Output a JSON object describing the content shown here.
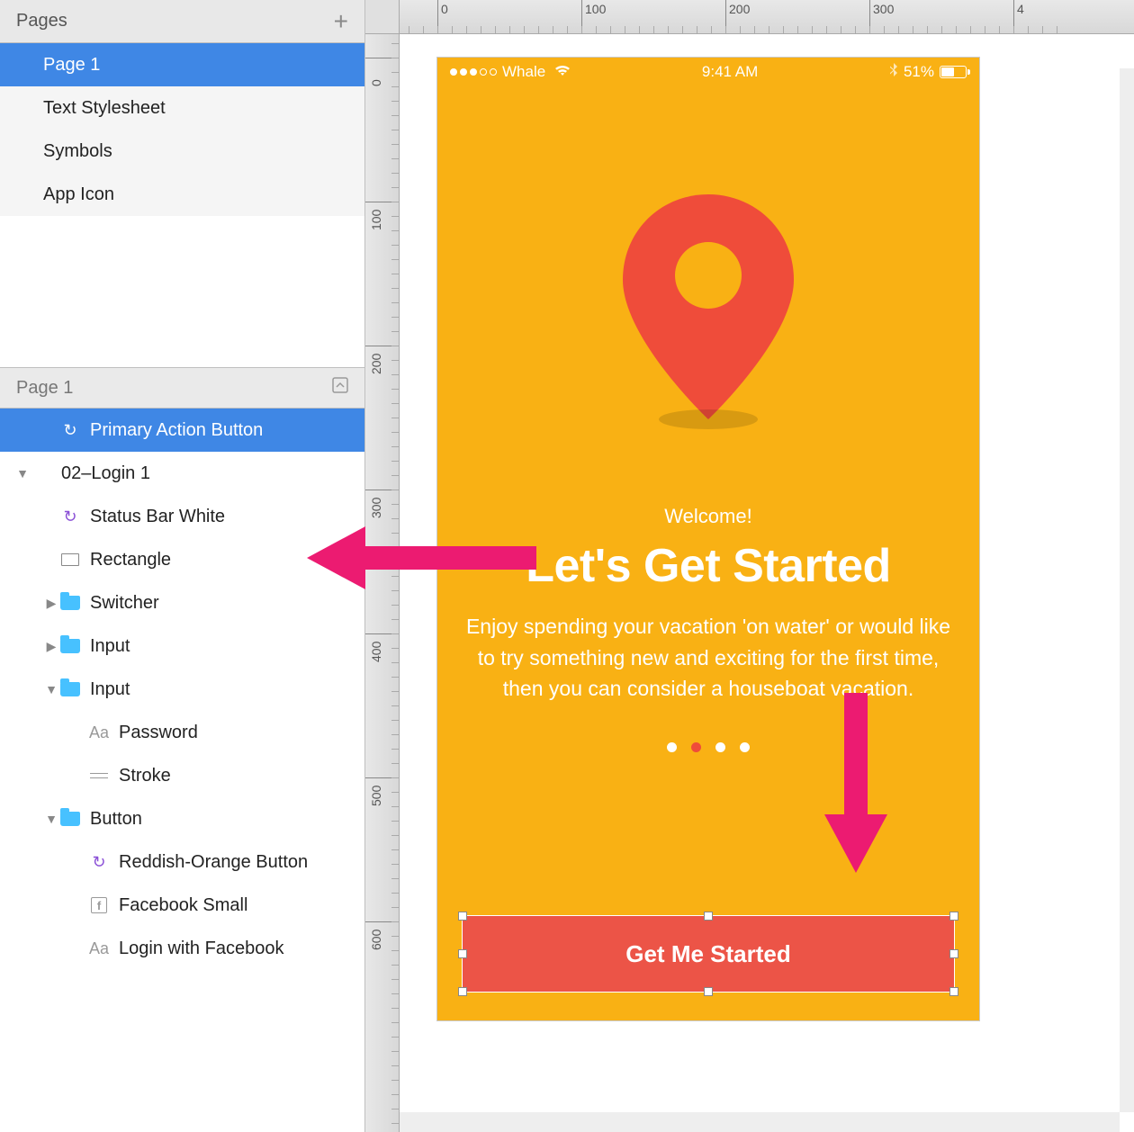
{
  "pages_panel": {
    "title": "Pages",
    "items": [
      "Page 1",
      "Text Stylesheet",
      "Symbols",
      "App Icon"
    ],
    "selected_index": 0
  },
  "layers_panel": {
    "title": "Page 1",
    "rows": [
      {
        "label": "Primary Action Button",
        "icon": "symbol",
        "indent": 1,
        "selected": true,
        "disclosure": ""
      },
      {
        "label": "02–Login 1",
        "icon": "",
        "indent": 0,
        "selected": false,
        "disclosure": "open"
      },
      {
        "label": "Status Bar White",
        "icon": "symbol",
        "indent": 1,
        "selected": false,
        "disclosure": ""
      },
      {
        "label": "Rectangle",
        "icon": "rect",
        "indent": 1,
        "selected": false,
        "disclosure": ""
      },
      {
        "label": "Switcher",
        "icon": "folder",
        "indent": 1,
        "selected": false,
        "disclosure": "closed"
      },
      {
        "label": "Input",
        "icon": "folder",
        "indent": 1,
        "selected": false,
        "disclosure": "closed"
      },
      {
        "label": "Input",
        "icon": "folder",
        "indent": 1,
        "selected": false,
        "disclosure": "open"
      },
      {
        "label": "Password",
        "icon": "text",
        "indent": 2,
        "selected": false,
        "disclosure": ""
      },
      {
        "label": "Stroke",
        "icon": "line",
        "indent": 2,
        "selected": false,
        "disclosure": ""
      },
      {
        "label": "Button",
        "icon": "folder",
        "indent": 1,
        "selected": false,
        "disclosure": "open"
      },
      {
        "label": "Reddish-Orange Button",
        "icon": "symbol",
        "indent": 2,
        "selected": false,
        "disclosure": ""
      },
      {
        "label": "Facebook Small",
        "icon": "fb",
        "indent": 2,
        "selected": false,
        "disclosure": ""
      },
      {
        "label": "Login with Facebook",
        "icon": "text",
        "indent": 2,
        "selected": false,
        "disclosure": ""
      }
    ]
  },
  "ruler_h": [
    "0",
    "100",
    "200",
    "300",
    "4"
  ],
  "ruler_v": [
    "0",
    "100",
    "200",
    "300",
    "400",
    "500",
    "600"
  ],
  "artboard": {
    "status": {
      "carrier": "Whale",
      "time": "9:41 AM",
      "battery_pct": "51%"
    },
    "welcome": "Welcome!",
    "headline": "Let's Get Started",
    "body": "Enjoy spending your vacation 'on water' or would like to try something new and exciting for the first time, then you can consider a houseboat vacation.",
    "cta_label": "Get Me Started",
    "pager_active": 1,
    "pager_count": 4
  },
  "colors": {
    "bg": "#F9B114",
    "accent": "#EF4C3A",
    "cta": "#EC5447",
    "arrow": "#EC1B71"
  }
}
